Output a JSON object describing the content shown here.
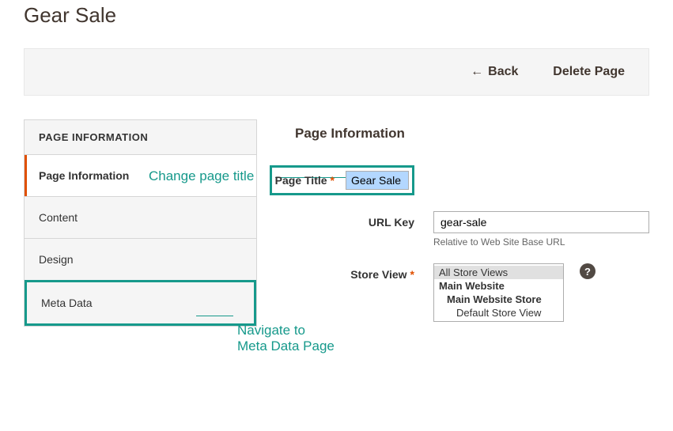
{
  "header": {
    "title": "Gear Sale"
  },
  "actions": {
    "back": "Back",
    "delete": "Delete Page"
  },
  "sidebar": {
    "heading": "PAGE INFORMATION",
    "tabs": [
      {
        "label": "Page Information"
      },
      {
        "label": "Content"
      },
      {
        "label": "Design"
      },
      {
        "label": "Meta Data"
      }
    ]
  },
  "form": {
    "section_title": "Page Information",
    "page_title": {
      "label": "Page Title",
      "value": "Gear Sale"
    },
    "url_key": {
      "label": "URL Key",
      "value": "gear-sale",
      "helper": "Relative to Web Site Base URL"
    },
    "store_view": {
      "label": "Store View",
      "options": {
        "all": "All Store Views",
        "main_website": "Main Website",
        "main_website_store": "Main Website Store",
        "default_store_view": "Default Store View"
      }
    }
  },
  "annotations": {
    "change_title": "Change page title",
    "navigate_meta_line1": "Navigate to",
    "navigate_meta_line2": "Meta Data Page"
  }
}
